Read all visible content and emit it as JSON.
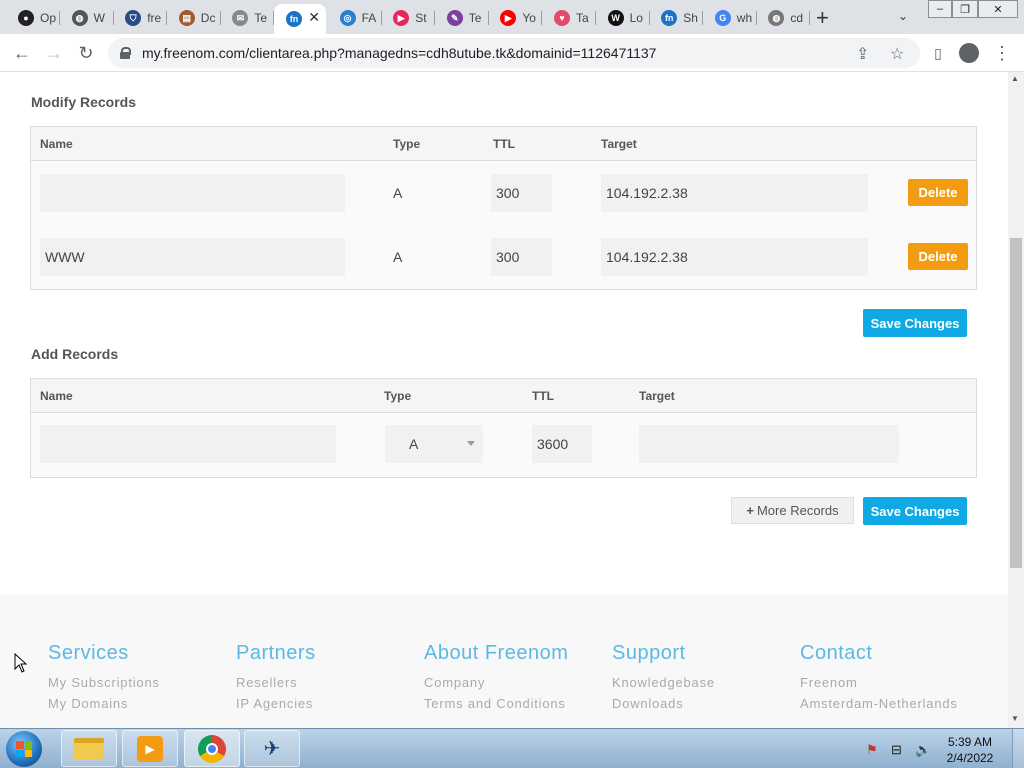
{
  "browser": {
    "tabs": [
      {
        "label": "Op",
        "icon": "circle-icon",
        "color": "#222222"
      },
      {
        "label": "W",
        "icon": "globe-icon",
        "color": "#555555"
      },
      {
        "label": "fre",
        "icon": "shield-icon",
        "color": "#2a4a8a"
      },
      {
        "label": "Dc",
        "icon": "document-icon",
        "color": "#a05a2c"
      },
      {
        "label": "Te",
        "icon": "mail-icon",
        "color": "#888888"
      },
      {
        "label": "",
        "icon": "freenom-icon",
        "color": "#1a73c7"
      },
      {
        "label": "FA",
        "icon": "click-icon",
        "color": "#2b7fd0"
      },
      {
        "label": "St",
        "icon": "play-icon",
        "color": "#e8265e"
      },
      {
        "label": "Te",
        "icon": "pen-icon",
        "color": "#7b3fa0"
      },
      {
        "label": "Yo",
        "icon": "youtube-icon",
        "color": "#ff0000"
      },
      {
        "label": "Ta",
        "icon": "heart-icon",
        "color": "#e04b6a"
      },
      {
        "label": "Lo",
        "icon": "wix-icon",
        "color": "#111111"
      },
      {
        "label": "Sh",
        "icon": "freenom-icon",
        "color": "#1a73c7"
      },
      {
        "label": "wh",
        "icon": "google-icon",
        "color": "#4285f4"
      },
      {
        "label": "cd",
        "icon": "globe-icon",
        "color": "#777777"
      }
    ],
    "active_tab_close": "✕",
    "new_tab": "+",
    "url": "my.freenom.com/clientarea.php?managedns=cdh8utube.tk&domainid=1126471137"
  },
  "modify": {
    "title": "Modify Records",
    "headers": {
      "name": "Name",
      "type": "Type",
      "ttl": "TTL",
      "target": "Target"
    },
    "rows": [
      {
        "name": "",
        "type": "A",
        "ttl": "300",
        "target": "104.192.2.38",
        "action": "Delete"
      },
      {
        "name": "WWW",
        "type": "A",
        "ttl": "300",
        "target": "104.192.2.38",
        "action": "Delete"
      }
    ],
    "save": "Save Changes"
  },
  "add": {
    "title": "Add Records",
    "headers": {
      "name": "Name",
      "type": "Type",
      "ttl": "TTL",
      "target": "Target"
    },
    "row": {
      "name": "",
      "type": "A",
      "ttl": "3600",
      "target": ""
    },
    "more": "More Records",
    "more_icon": "+",
    "save": "Save Changes"
  },
  "footer": {
    "columns": [
      {
        "heading": "Services",
        "links": [
          "My Subscriptions",
          "My Domains"
        ]
      },
      {
        "heading": "Partners",
        "links": [
          "Resellers",
          "IP Agencies"
        ]
      },
      {
        "heading": "About Freenom",
        "links": [
          "Company",
          "Terms and Conditions"
        ]
      },
      {
        "heading": "Support",
        "links": [
          "Knowledgebase",
          "Downloads"
        ]
      },
      {
        "heading": "Contact",
        "links": [
          "Freenom",
          "Amsterdam-Netherlands"
        ]
      }
    ]
  },
  "taskbar": {
    "time": "5:39 AM",
    "date": "2/4/2022"
  }
}
